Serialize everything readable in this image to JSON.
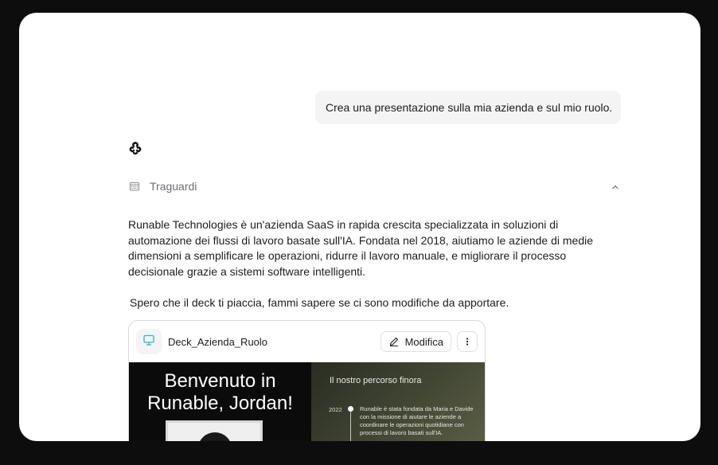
{
  "user_message": "Crea una presentazione sulla mia azienda e sul mio ruolo.",
  "assistant": {
    "logo_icon": "runable-logo-icon",
    "milestones_label": "Traguardi",
    "milestones_icon": "calendar-icon",
    "paragraph": "Runable Technologies è un'azienda SaaS in rapida crescita specializzata in soluzioni di automazione dei flussi di lavoro basate sull'IA. Fondata nel 2018, aiutiamo le aziende di medie dimensioni a semplificare le operazioni, ridurre il lavoro manuale, e migliorare il processo decisionale grazie a sistemi software intelligenti.",
    "closing": "Spero che il deck ti piaccia, fammi sapere se ci sono modifiche da apportare."
  },
  "file_card": {
    "file_name": "Deck_Azienda_Ruolo",
    "file_icon": "presentation-icon",
    "edit_label": "Modifica",
    "accent": "#2bb6c8"
  },
  "slides": {
    "welcome_title": "Benvenuto in Runable, Jordan!",
    "journey_title": "Il nostro percorso finora",
    "timeline": [
      {
        "year": "2022",
        "text": "Runable è stata fondata da Maria e Davide con la missione di aiutare le aziende a coordinare le operazioni quotidiane con processi di lavoro basati sull'IA."
      }
    ]
  }
}
